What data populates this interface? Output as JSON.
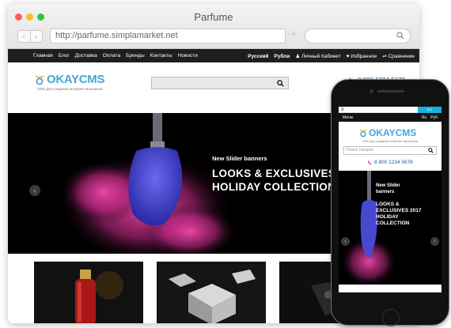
{
  "window": {
    "title": "Parfume"
  },
  "browser": {
    "nav_back": "‹",
    "nav_forward": "›",
    "url": "http://parfume.simplamarket.net",
    "new_tab": "+"
  },
  "site": {
    "nav_links": [
      "Главная",
      "Блог",
      "Доставка",
      "Оплата",
      "Бренды",
      "Контакты",
      "Новости"
    ],
    "language": "Русский",
    "currency": "Рубли",
    "account": "Личный Кабинет",
    "favorites": "Избранное",
    "compare": "Сравнение",
    "logo": {
      "text": "OKAYCMS",
      "tagline": "CMS для создания интернет-магазинов"
    },
    "phone": "8 800 1234 5678",
    "hero": {
      "subtitle": "New Slider banners",
      "title_line1": "LOOKS & EXCLUSIVES",
      "title_line2": "HOLIDAY COLLECTION",
      "prev": "‹"
    }
  },
  "mobile": {
    "cart": "$ 0",
    "menu": "Меню",
    "language": "Ru",
    "currency": "Руб",
    "logo_text": "OKAYCMS",
    "tagline": "CMS для создания интернет-магазинов",
    "search_placeholder": "Поиск товаров",
    "phone": "8 800 1234 5678",
    "hero": {
      "subtitle": "New Slider banners",
      "title": "LOOKS & EXCLUSIVES 2017 HOLIDAY COLLECTION",
      "prev": "‹",
      "next": "›"
    }
  },
  "colors": {
    "brand_blue": "#47a6d8",
    "accent_cyan": "#14b3e0",
    "powder_pink": "#e23a9e",
    "brush_blue": "#3c3cc8",
    "logo_gold": "#e9b23a"
  }
}
